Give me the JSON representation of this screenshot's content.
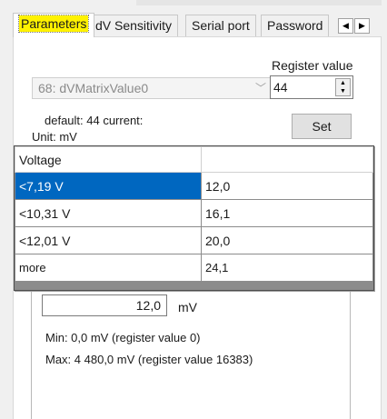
{
  "tabs": [
    {
      "label": "Parameters",
      "active": true
    },
    {
      "label": "dV Sensitivity",
      "active": false
    },
    {
      "label": "Serial port",
      "active": false
    },
    {
      "label": "Password",
      "active": false
    }
  ],
  "tab_scroll": {
    "left_icon": "triangle-left",
    "right_icon": "triangle-right"
  },
  "parameter_select": {
    "value": "68: dVMatrixValue0"
  },
  "register": {
    "label": "Register value",
    "value": "44"
  },
  "info": {
    "default_current": "default: 44 current:",
    "unit": "Unit: mV"
  },
  "set_button": {
    "label": "Set"
  },
  "grid": {
    "header": [
      "Voltage",
      ""
    ],
    "rows": [
      {
        "voltage": "<7,19 V",
        "value": "12,0",
        "selected": true
      },
      {
        "voltage": "<10,31 V",
        "value": "16,1",
        "selected": false
      },
      {
        "voltage": "<12,01 V",
        "value": "20,0",
        "selected": false
      },
      {
        "voltage": "more",
        "value": "24,1",
        "selected": false
      }
    ]
  },
  "value_entry": {
    "value": "12,0",
    "unit": "mV"
  },
  "limits": {
    "min": "Min: 0,0 mV (register value 0)",
    "max": "Max: 4 480,0 mV (register value 16383)"
  },
  "colors": {
    "highlight_tab": "#fff200",
    "selection": "#0067c0"
  }
}
